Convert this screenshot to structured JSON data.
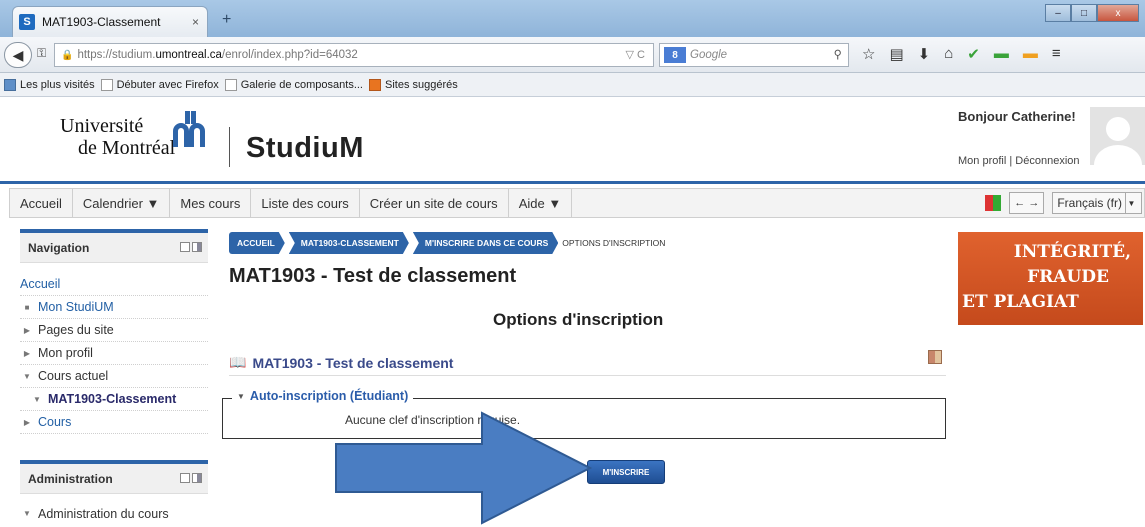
{
  "browser": {
    "tab_title": "MAT1903-Classement",
    "favicon_letter": "S",
    "new_tab": "+",
    "url_prefix": "https://studium.",
    "url_domain": "umontreal.ca",
    "url_path": "/enrol/index.php?id=64032",
    "url_tools": "▽ C",
    "search_placeholder": "Google",
    "search_engine_badge": "8",
    "bookmarks": [
      "Les plus visités",
      "Débuter avec Firefox",
      "Galerie de composants...",
      "Sites suggérés"
    ],
    "window_controls": [
      "–",
      "□",
      "x"
    ]
  },
  "header": {
    "logo_line1": "Université",
    "logo_line2": "de Montréal",
    "site_name": "StudiuM",
    "greeting": "Bonjour Catherine!",
    "profile_link": "Mon profil",
    "separator": "|",
    "logout_link": "Déconnexion"
  },
  "menu": {
    "items": [
      "Accueil",
      "Calendrier ▼",
      "Mes cours",
      "Liste des cours",
      "Créer un site de cours",
      "Aide ▼"
    ],
    "language": "Français (fr)",
    "arrows": "← →"
  },
  "navigation_block": {
    "title": "Navigation",
    "items": [
      {
        "label": "Accueil",
        "style": "link"
      },
      {
        "label": "Mon StudiUM",
        "style": "link"
      },
      {
        "label": "Pages du site",
        "style": "dark"
      },
      {
        "label": "Mon profil",
        "style": "dark"
      },
      {
        "label": "Cours actuel",
        "style": "dark"
      },
      {
        "label": "MAT1903-Classement",
        "style": "bold"
      },
      {
        "label": "Cours",
        "style": "link"
      }
    ]
  },
  "admin_block": {
    "title": "Administration",
    "items": [
      "Administration du cours"
    ]
  },
  "breadcrumb": [
    "ACCUEIL",
    "MAT1903-CLASSEMENT",
    "M'INSCRIRE DANS CE COURS",
    "OPTIONS D'INSCRIPTION"
  ],
  "main": {
    "page_title": "MAT1903 - Test de classement",
    "section_title": "Options d'inscription",
    "course_name": "MAT1903 - Test de classement",
    "enrol_method": "Auto-inscription (Étudiant)",
    "enrol_note": "Aucune clef d'inscription requise.",
    "enrol_button": "M'INSCRIRE"
  },
  "banner": {
    "line1": "INTÉGRITÉ,",
    "line2": "FRAUDE",
    "line3": "ET PLAGIAT"
  },
  "colors": {
    "accent_blue": "#2d64a8",
    "banner_orange": "#d8582a",
    "arrow_fill": "#4a7dc2",
    "arrow_stroke": "#2f5a93"
  }
}
